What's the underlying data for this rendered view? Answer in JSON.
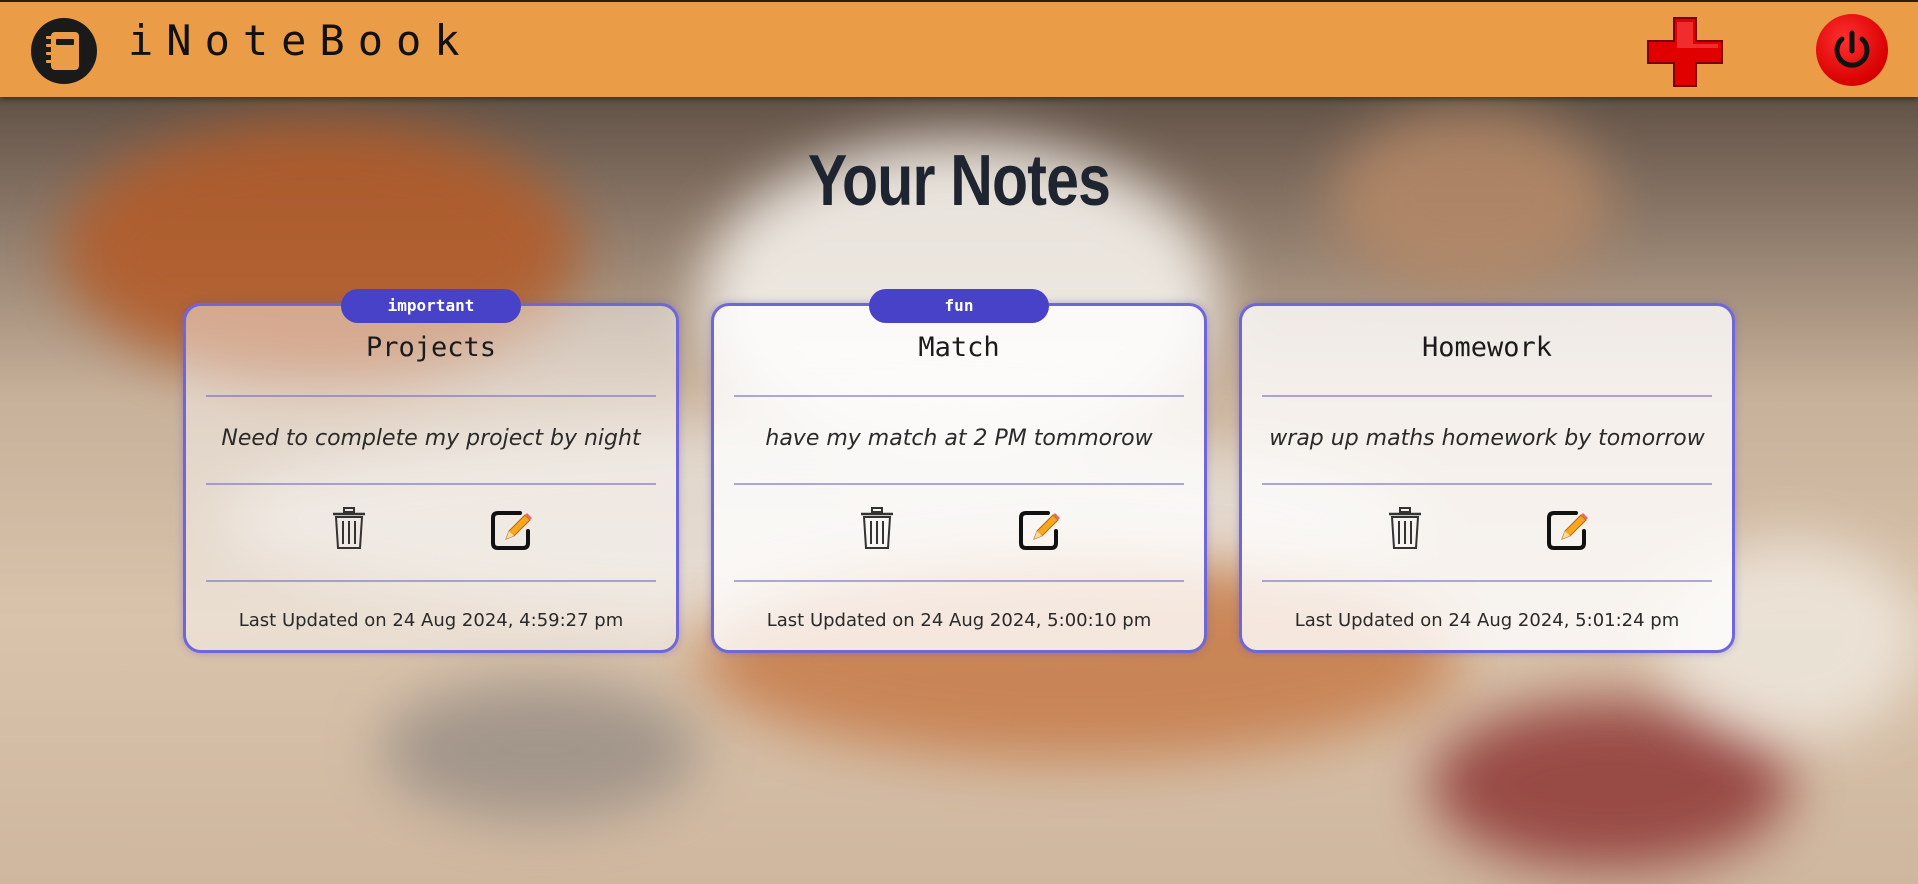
{
  "app": {
    "brand": "iNoteBook"
  },
  "navbar": {
    "add_icon": "plus-icon",
    "power_icon": "power-icon",
    "logo_icon": "notebook-icon"
  },
  "heading": "Your Notes",
  "colors": {
    "navbar": "#eb9c46",
    "tag": "#4842c8",
    "card_border": "#6f66d8",
    "add": "#e00000",
    "power": "#d80000"
  },
  "notes": [
    {
      "tag": "important",
      "title": "Projects",
      "description": "Need to complete my project by night",
      "updated": "Last Updated on 24 Aug 2024, 4:59:27 pm"
    },
    {
      "tag": "fun",
      "title": "Match",
      "description": "have my match at 2 PM tommorow",
      "updated": "Last Updated on 24 Aug 2024, 5:00:10 pm"
    },
    {
      "tag": "",
      "title": "Homework",
      "description": "wrap up maths homework by tomorrow",
      "updated": "Last Updated on 24 Aug 2024, 5:01:24 pm"
    }
  ]
}
